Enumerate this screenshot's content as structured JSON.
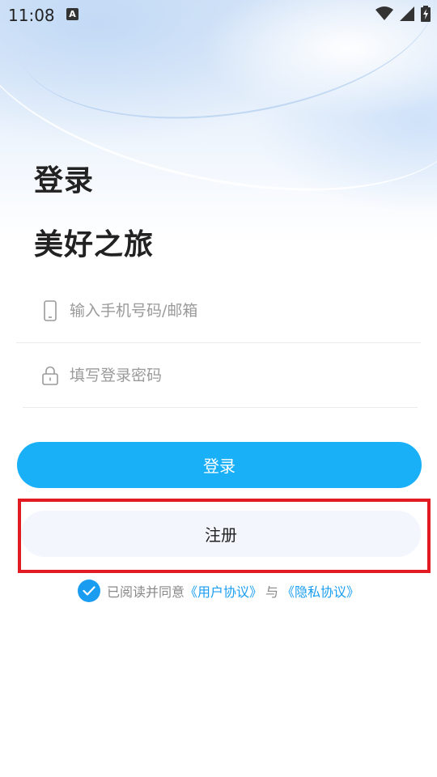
{
  "status_bar": {
    "time": "11:08",
    "notification_icon_label": "A",
    "icons": [
      "wifi-icon",
      "signal-icon",
      "battery-charging-icon"
    ]
  },
  "page": {
    "title": "登录",
    "subtitle": "美好之旅"
  },
  "form": {
    "phone_placeholder": "输入手机号码/邮箱",
    "phone_value": "",
    "phone_icon": "phone-icon",
    "password_placeholder": "填写登录密码",
    "password_value": "",
    "password_icon": "lock-icon"
  },
  "buttons": {
    "login_label": "登录",
    "register_label": "注册"
  },
  "agreement": {
    "checked": true,
    "prefix": "已阅读并同意",
    "user_agreement": "《用户协议》",
    "connector": "与",
    "privacy_policy": "《隐私协议》"
  },
  "colors": {
    "accent": "#1ab0f7",
    "register_bg": "#f3f7fd",
    "highlight": "#e21b23",
    "link": "#1a9df0"
  }
}
